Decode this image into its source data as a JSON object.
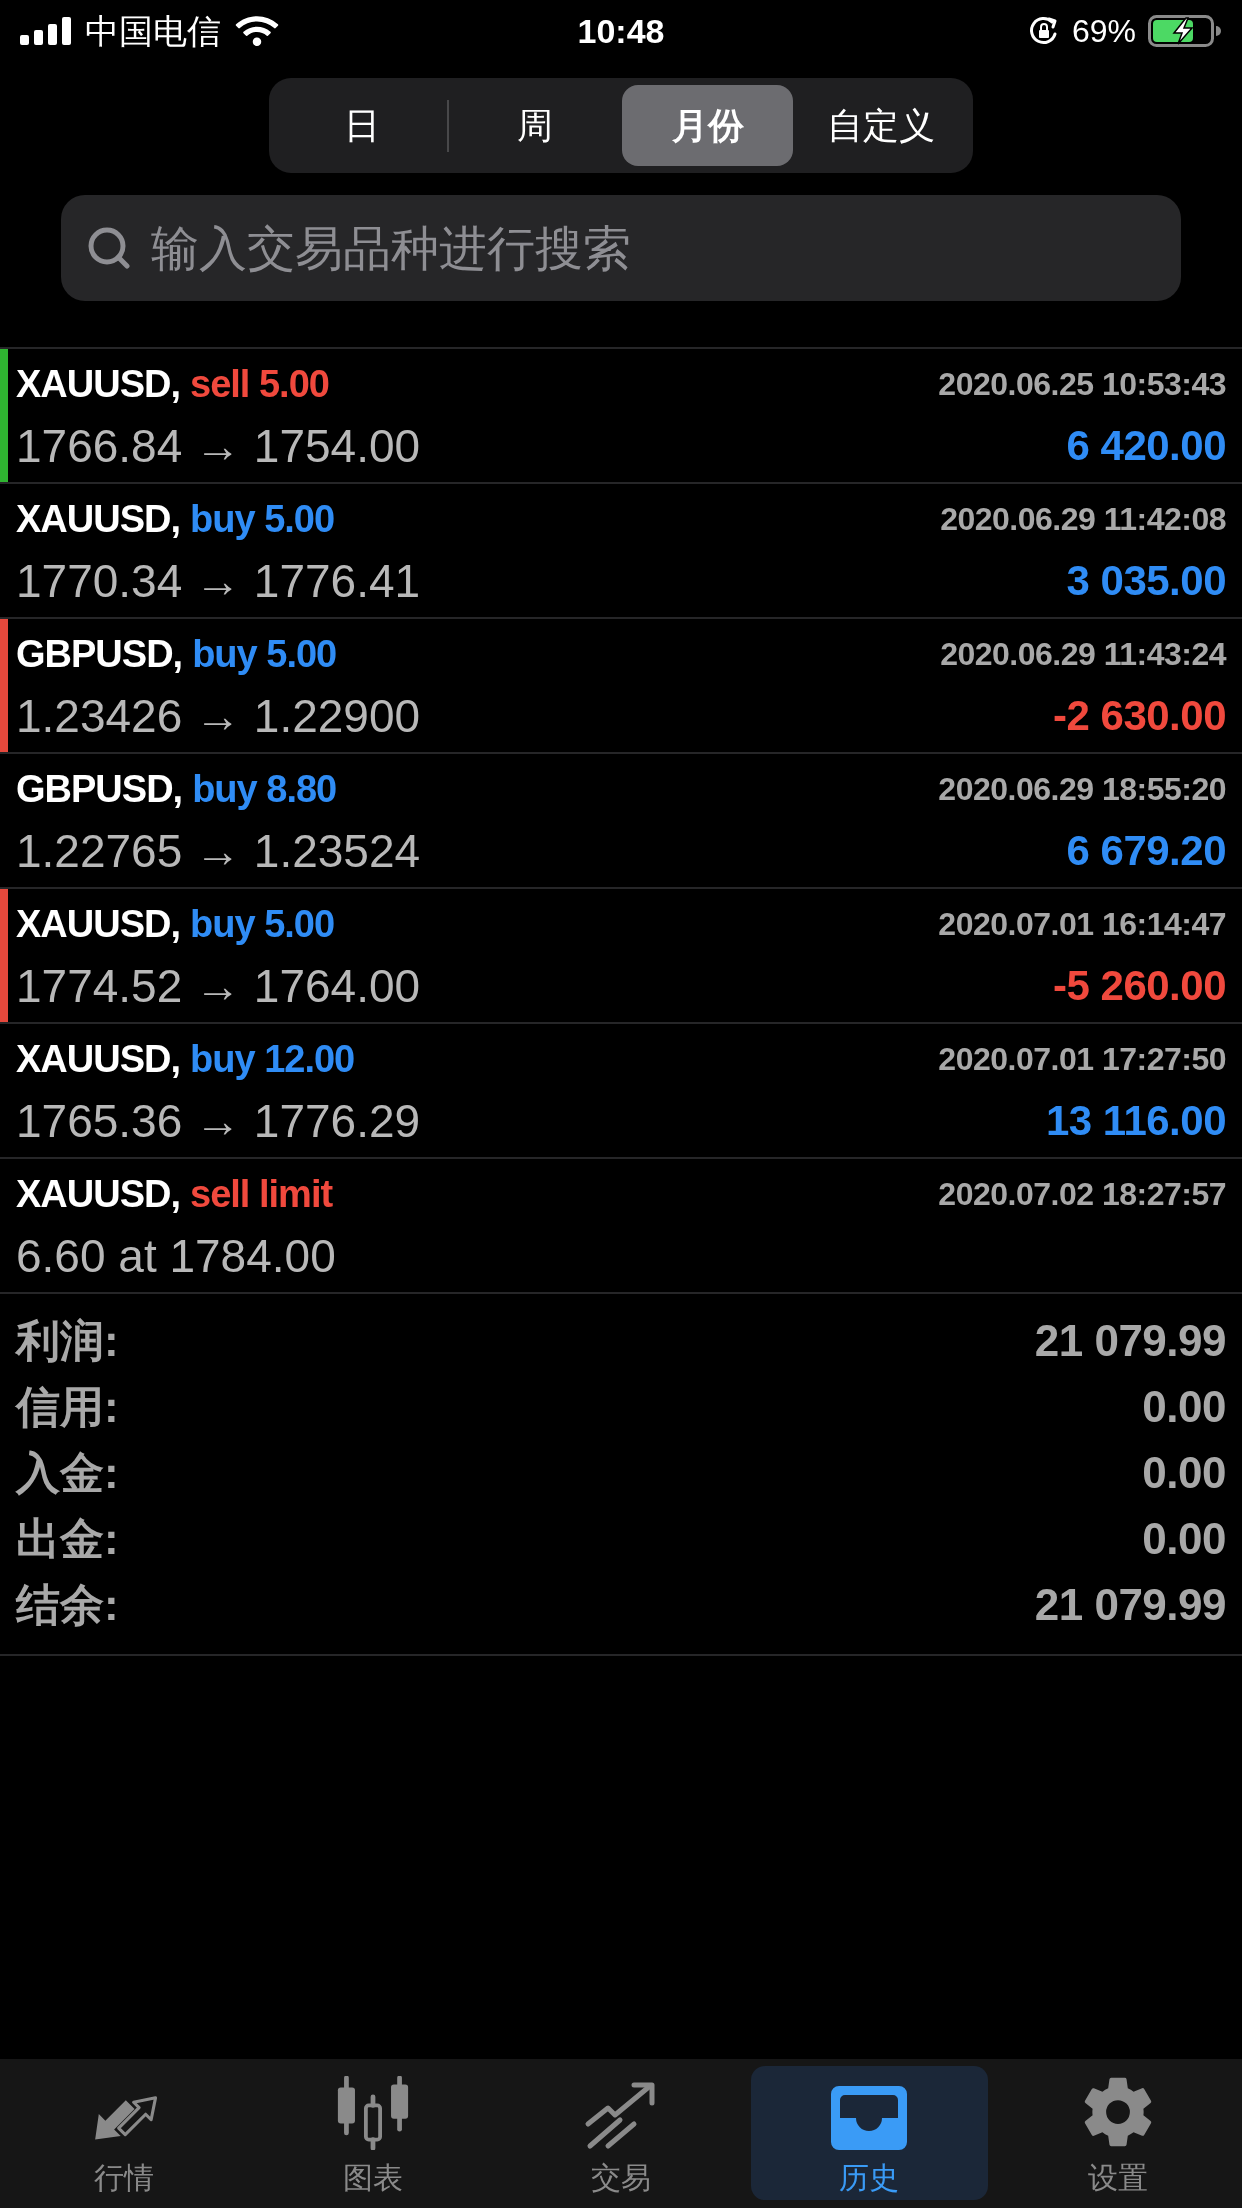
{
  "status_bar": {
    "carrier": "中国电信",
    "time": "10:48",
    "battery": "69%"
  },
  "period_tabs": [
    {
      "label": "日",
      "selected": false
    },
    {
      "label": "周",
      "selected": false
    },
    {
      "label": "月份",
      "selected": true
    },
    {
      "label": "自定义",
      "selected": false
    }
  ],
  "search": {
    "placeholder": "输入交易品种进行搜索"
  },
  "trades": [
    {
      "symbol": "XAUUSD,",
      "action": {
        "text": "sell 5.00",
        "kind": "sell"
      },
      "time": "2020.06.25 10:53:43",
      "prices": "1766.84 → 1754.00",
      "profit": {
        "text": "6 420.00",
        "kind": "gain"
      },
      "color": "#2fb531"
    },
    {
      "symbol": "XAUUSD,",
      "action": {
        "text": "buy 5.00",
        "kind": "buy"
      },
      "time": "2020.06.29 11:42:08",
      "prices": "1770.34 → 1776.41",
      "profit": {
        "text": "3 035.00",
        "kind": "gain"
      }
    },
    {
      "symbol": "GBPUSD,",
      "action": {
        "text": "buy 5.00",
        "kind": "buy"
      },
      "time": "2020.06.29 11:43:24",
      "prices": "1.23426 → 1.22900",
      "profit": {
        "text": "-2 630.00",
        "kind": "loss"
      },
      "color": "#e5483c"
    },
    {
      "symbol": "GBPUSD,",
      "action": {
        "text": "buy 8.80",
        "kind": "buy"
      },
      "time": "2020.06.29 18:55:20",
      "prices": "1.22765 → 1.23524",
      "profit": {
        "text": "6 679.20",
        "kind": "gain"
      }
    },
    {
      "symbol": "XAUUSD,",
      "action": {
        "text": "buy 5.00",
        "kind": "buy"
      },
      "time": "2020.07.01 16:14:47",
      "prices": "1774.52 → 1764.00",
      "profit": {
        "text": "-5 260.00",
        "kind": "loss"
      },
      "color": "#e5483c"
    },
    {
      "symbol": "XAUUSD,",
      "action": {
        "text": "buy 12.00",
        "kind": "buy"
      },
      "time": "2020.07.01 17:27:50",
      "prices": "1765.36 → 1776.29",
      "profit": {
        "text": "13 116.00",
        "kind": "gain"
      }
    },
    {
      "symbol": "XAUUSD,",
      "action": {
        "text": "sell limit",
        "kind": "sell"
      },
      "time": "2020.07.02 18:27:57",
      "prices": "6.60 at 1784.00"
    }
  ],
  "summary": [
    {
      "label": "利润:",
      "value": "21 079.99"
    },
    {
      "label": "信用:",
      "value": "0.00"
    },
    {
      "label": "入金:",
      "value": "0.00"
    },
    {
      "label": "出金:",
      "value": "0.00"
    },
    {
      "label": "结余:",
      "value": "21 079.99"
    }
  ],
  "tab_bar": [
    {
      "label": "行情",
      "kind": "quotes",
      "selected": false
    },
    {
      "label": "图表",
      "kind": "chart",
      "selected": false
    },
    {
      "label": "交易",
      "kind": "trade",
      "selected": false
    },
    {
      "label": "历史",
      "kind": "history",
      "selected": true
    },
    {
      "label": "设置",
      "kind": "settings",
      "selected": false
    }
  ]
}
